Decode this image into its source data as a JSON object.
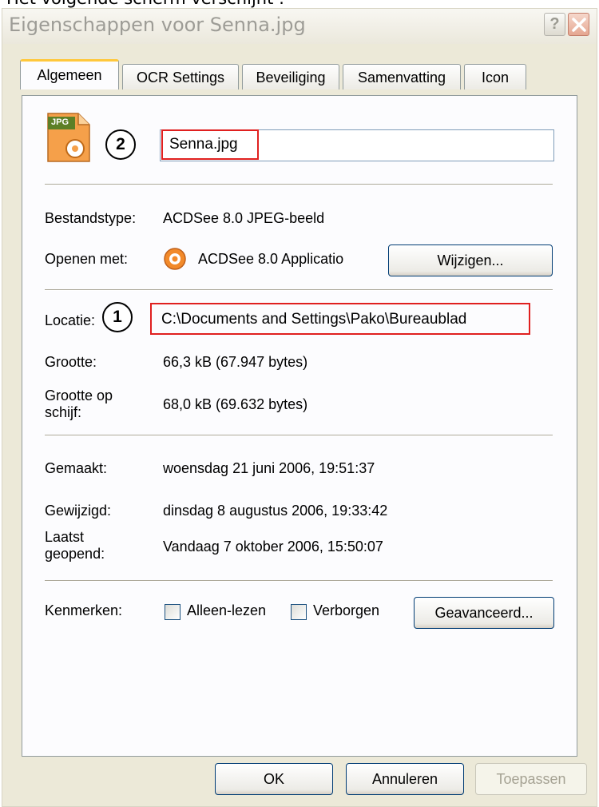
{
  "caption": "Het volgende scherm verschijnt :",
  "window": {
    "title": "Eigenschappen voor Senna.jpg",
    "help_symbol": "?"
  },
  "tabs": [
    {
      "label": "Algemeen"
    },
    {
      "label": "OCR Settings"
    },
    {
      "label": "Beveiliging"
    },
    {
      "label": "Samenvatting"
    },
    {
      "label": "Icon"
    }
  ],
  "file": {
    "icon_label": "JPG",
    "name": "Senna.jpg",
    "callout_name": "2",
    "callout_location": "1"
  },
  "type_row": {
    "label": "Bestandstype:",
    "value": "ACDSee 8.0 JPEG-beeld"
  },
  "open_with": {
    "label": "Openen met:",
    "value": "ACDSee 8.0 Applicatio",
    "button": "Wijzigen..."
  },
  "location": {
    "label": "Locatie:",
    "value": "C:\\Documents and Settings\\Pako\\Bureaublad"
  },
  "size": {
    "label": "Grootte:",
    "value": "66,3 kB (67.947 bytes)"
  },
  "size_on_disk": {
    "label_line1": "Grootte op",
    "label_line2": "schijf:",
    "value": "68,0 kB (69.632 bytes)"
  },
  "created": {
    "label": "Gemaakt:",
    "value": "woensdag 21 juni 2006, 19:51:37"
  },
  "modified": {
    "label": "Gewijzigd:",
    "value": "dinsdag 8 augustus 2006, 19:33:42"
  },
  "accessed": {
    "label_line1": "Laatst",
    "label_line2": "geopend:",
    "value": "Vandaag 7 oktober 2006, 15:50:07"
  },
  "attributes": {
    "label": "Kenmerken:",
    "readonly_label": "Alleen-lezen",
    "readonly_checked": false,
    "hidden_label": "Verborgen",
    "hidden_checked": false,
    "advanced_button": "Geavanceerd..."
  },
  "footer": {
    "ok": "OK",
    "cancel": "Annuleren",
    "apply": "Toepassen"
  },
  "colors": {
    "dialog_bg": "#ece9d8",
    "panel_bg": "#fcfcfe",
    "annotation_red": "#e0201f",
    "tab_highlight": "#ffc83c"
  }
}
